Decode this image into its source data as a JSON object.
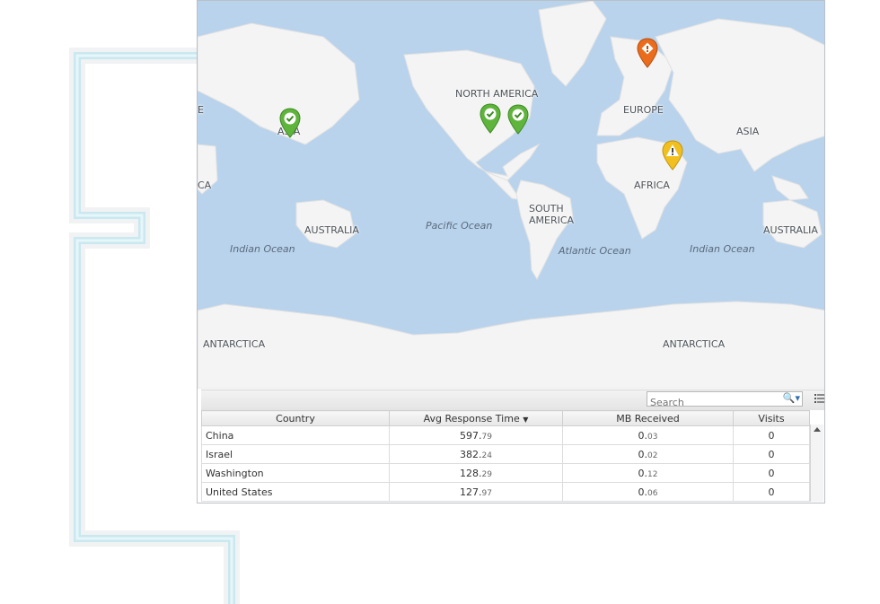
{
  "map": {
    "continents": {
      "north_america": "NORTH AMERICA",
      "europe": "EUROPE",
      "asia_left": "ASIA",
      "asia_right": "ASIA",
      "africa": "AFRICA",
      "africa_left": "CA",
      "europe_left": "E",
      "australia_left": "AUSTRALIA",
      "australia_right": "AUSTRALIA",
      "south_america": "SOUTH AMERICA",
      "antarctica_left": "ANTARCTICA",
      "antarctica_right": "ANTARCTICA"
    },
    "oceans": {
      "indian_left": "Indian Ocean",
      "pacific": "Pacific Ocean",
      "atlantic": "Atlantic Ocean",
      "indian_right": "Indian Ocean"
    },
    "colors": {
      "ok": "#5fb53c",
      "warning": "#f2c01e",
      "error": "#ea6c1d",
      "water": "#b9d3ec"
    }
  },
  "toolbar": {
    "search_placeholder": "Search"
  },
  "grid": {
    "columns": [
      "Country",
      "Avg Response Time",
      "MB Received",
      "Visits"
    ],
    "rows": [
      {
        "country": "China",
        "resp_int": "597.",
        "resp_dec": "79",
        "mb_int": "0.",
        "mb_dec": "03",
        "visits": "0"
      },
      {
        "country": "Israel",
        "resp_int": "382.",
        "resp_dec": "24",
        "mb_int": "0.",
        "mb_dec": "02",
        "visits": "0"
      },
      {
        "country": "Washington",
        "resp_int": "128.",
        "resp_dec": "29",
        "mb_int": "0.",
        "mb_dec": "12",
        "visits": "0"
      },
      {
        "country": "United States",
        "resp_int": "127.",
        "resp_dec": "97",
        "mb_int": "0.",
        "mb_dec": "06",
        "visits": "0"
      }
    ]
  }
}
